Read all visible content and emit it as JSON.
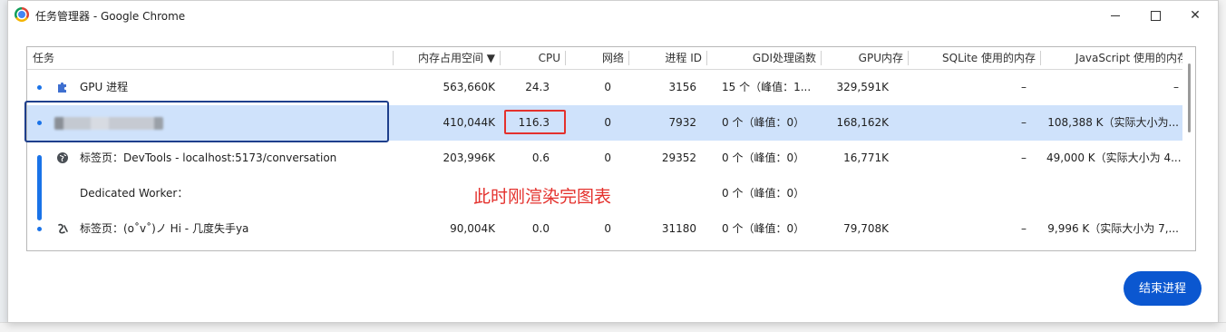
{
  "window": {
    "title": "任务管理器 - Google Chrome",
    "icon": "chrome-icon"
  },
  "columns": [
    {
      "label": "任务"
    },
    {
      "label": "内存占用空间 ▼"
    },
    {
      "label": "CPU"
    },
    {
      "label": "网络"
    },
    {
      "label": "进程 ID"
    },
    {
      "label": "GDI处理函数"
    },
    {
      "label": "GPU内存"
    },
    {
      "label": "SQLite 使用的内存"
    },
    {
      "label": "JavaScript 使用的内存"
    }
  ],
  "rows": [
    {
      "task": "GPU 进程",
      "icon": "puzzle-icon",
      "memory": "563,660K",
      "cpu": "24.3",
      "network": "0",
      "pid": "3156",
      "gdi": "15 个（峰值：1...",
      "gpu": "329,591K",
      "sqlite": "–",
      "js": "–"
    },
    {
      "task": "",
      "icon": "blurred-favicon",
      "memory": "410,044K",
      "cpu": "116.3",
      "network": "0",
      "pid": "7932",
      "gdi": "0 个（峰值：0）",
      "gpu": "168,162K",
      "sqlite": "–",
      "js": "108,388 K（实际大小为..."
    },
    {
      "task": "标签页：DevTools - localhost:5173/conversation",
      "icon": "globe-icon",
      "memory": "203,996K",
      "cpu": "0.6",
      "network": "0",
      "pid": "29352",
      "gdi": "0 个（峰值：0）",
      "gpu": "16,771K",
      "sqlite": "–",
      "js": "49,000 K（实际大小为 4..."
    },
    {
      "task": "Dedicated Worker：",
      "icon": "",
      "memory": "",
      "cpu": "",
      "network": "",
      "pid": "",
      "gdi": "0 个（峰值：0）",
      "gpu": "",
      "sqlite": "",
      "js": ""
    },
    {
      "task": "标签页：(o˚v˚)ノ Hi - 几度失手ya",
      "icon": "anchor-icon",
      "memory": "90,004K",
      "cpu": "0.0",
      "network": "0",
      "pid": "31180",
      "gdi": "0 个（峰值：0）",
      "gpu": "79,708K",
      "sqlite": "–",
      "js": "9,996 K（实际大小为 7,..."
    }
  ],
  "annotation": "此时刚渲染完图表",
  "end_button": "结束进程",
  "colors": {
    "accent": "#0b57d0",
    "selected_row": "#cfe2fb",
    "annotation": "#e4312d"
  }
}
